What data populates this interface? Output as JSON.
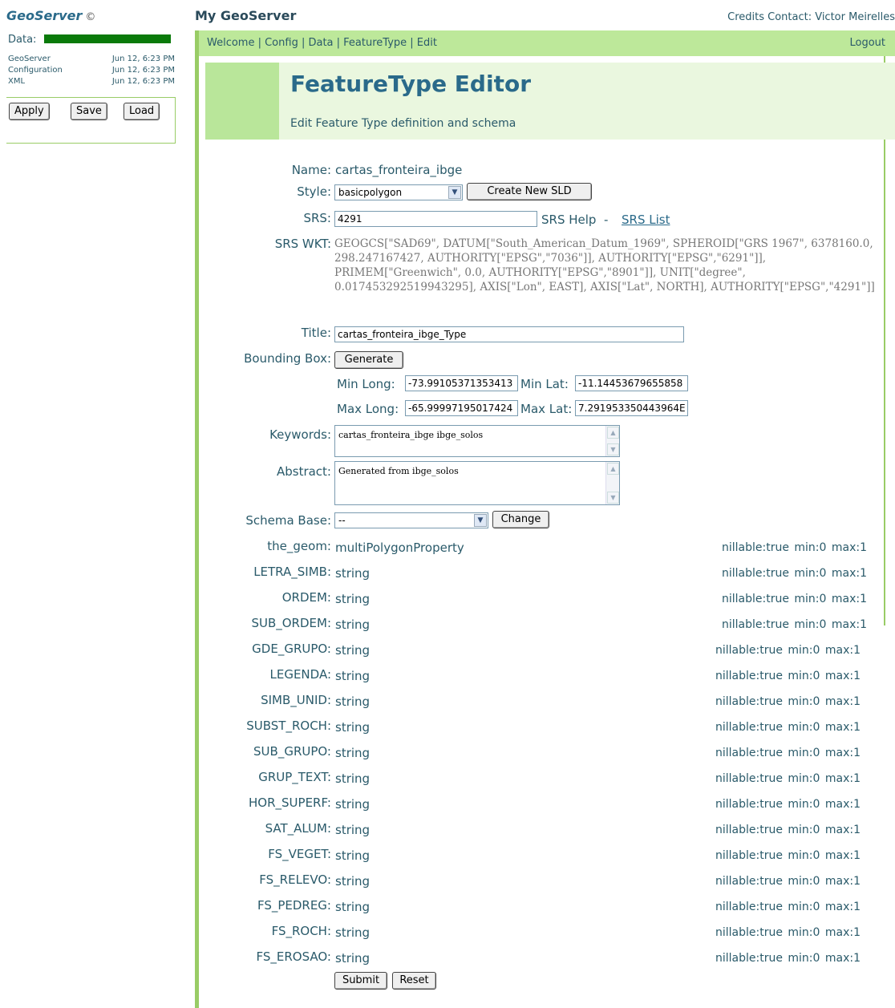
{
  "sidebar": {
    "logo": "GeoServer",
    "logo_mark": "©",
    "data_label": "Data:",
    "status": [
      {
        "label": "GeoServer",
        "time": "Jun 12, 6:23 PM"
      },
      {
        "label": "Configuration",
        "time": "Jun 12, 6:23 PM"
      },
      {
        "label": "XML",
        "time": "Jun 12, 6:23 PM"
      }
    ],
    "buttons": {
      "apply": "Apply",
      "save": "Save",
      "load": "Load"
    }
  },
  "header": {
    "title": "My GeoServer",
    "credits": "Credits Contact: Victor Meirelles",
    "breadcrumb": "Welcome | Config | Data | FeatureType | Edit",
    "logout": "Logout"
  },
  "page": {
    "title": "FeatureType Editor",
    "subtitle": "Edit Feature Type definition and schema"
  },
  "form": {
    "name_label": "Name:",
    "name_value": "cartas_fronteira_ibge",
    "style_label": "Style:",
    "style_value": "basicpolygon",
    "create_sld": "Create New SLD",
    "srs_label": "SRS:",
    "srs_value": "4291",
    "srs_help": "SRS Help",
    "srs_sep": "-",
    "srs_list": "SRS List",
    "srs_wkt_label": "SRS WKT:",
    "srs_wkt": "GEOGCS[\"SAD69\", DATUM[\"South_American_Datum_1969\", SPHEROID[\"GRS 1967\", 6378160.0, 298.247167427, AUTHORITY[\"EPSG\",\"7036\"]], AUTHORITY[\"EPSG\",\"6291\"]], PRIMEM[\"Greenwich\", 0.0, AUTHORITY[\"EPSG\",\"8901\"]], UNIT[\"degree\", 0.017453292519943295], AXIS[\"Lon\", EAST], AXIS[\"Lat\", NORTH], AUTHORITY[\"EPSG\",\"4291\"]]",
    "title_label": "Title:",
    "title_value": "cartas_fronteira_ibge_Type",
    "bbox_label": "Bounding Box:",
    "generate": "Generate",
    "min_long_label": "Min Long:",
    "min_long": "-73.99105371353413",
    "min_lat_label": "Min Lat:",
    "min_lat": "-11.14453679655858",
    "max_long_label": "Max Long:",
    "max_long": "-65.99997195017424",
    "max_lat_label": "Max Lat:",
    "max_lat": "7.291953350443964E",
    "keywords_label": "Keywords:",
    "keywords": "cartas_fronteira_ibge ibge_solos",
    "abstract_label": "Abstract:",
    "abstract": "Generated from ibge_solos",
    "schema_label": "Schema Base:",
    "schema_value": "--",
    "change": "Change",
    "submit": "Submit",
    "reset": "Reset"
  },
  "attributes": [
    {
      "name": "the_geom:",
      "type": "multiPolygonProperty",
      "meta": "nillable:true  min:0  max:1"
    },
    {
      "name": "LETRA_SIMB:",
      "type": "string",
      "meta": "nillable:true  min:0  max:1"
    },
    {
      "name": "ORDEM:",
      "type": "string",
      "meta": "nillable:true  min:0  max:1"
    },
    {
      "name": "SUB_ORDEM:",
      "type": "string",
      "meta": "nillable:true  min:0  max:1"
    },
    {
      "name": "GDE_GRUPO:",
      "type": "string",
      "meta": "nillable:true  min:0  max:1"
    },
    {
      "name": "LEGENDA:",
      "type": "string",
      "meta": "nillable:true  min:0  max:1"
    },
    {
      "name": "SIMB_UNID:",
      "type": "string",
      "meta": "nillable:true  min:0  max:1"
    },
    {
      "name": "SUBST_ROCH:",
      "type": "string",
      "meta": "nillable:true  min:0  max:1"
    },
    {
      "name": "SUB_GRUPO:",
      "type": "string",
      "meta": "nillable:true  min:0  max:1"
    },
    {
      "name": "GRUP_TEXT:",
      "type": "string",
      "meta": "nillable:true  min:0  max:1"
    },
    {
      "name": "HOR_SUPERF:",
      "type": "string",
      "meta": "nillable:true  min:0  max:1"
    },
    {
      "name": "SAT_ALUM:",
      "type": "string",
      "meta": "nillable:true  min:0  max:1"
    },
    {
      "name": "FS_VEGET:",
      "type": "string",
      "meta": "nillable:true  min:0  max:1"
    },
    {
      "name": "FS_RELEVO:",
      "type": "string",
      "meta": "nillable:true  min:0  max:1"
    },
    {
      "name": "FS_PEDREG:",
      "type": "string",
      "meta": "nillable:true  min:0  max:1"
    },
    {
      "name": "FS_ROCH:",
      "type": "string",
      "meta": "nillable:true  min:0  max:1"
    },
    {
      "name": "FS_EROSAO:",
      "type": "string",
      "meta": "nillable:true  min:0  max:1"
    }
  ],
  "colors": {
    "accent": "#bde89a",
    "frame": "#99cc66",
    "data_bar": "#0a7a0a",
    "text": "#2a5a6a"
  }
}
